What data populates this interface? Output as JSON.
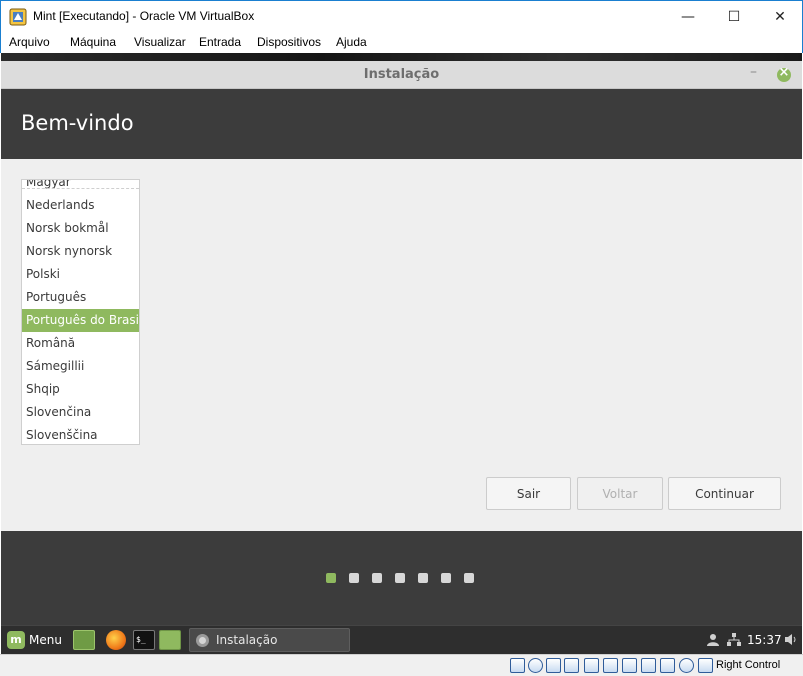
{
  "window": {
    "title": "Mint [Executando] - Oracle VM VirtualBox",
    "controls": {
      "minimize": "—",
      "maximize": "☐",
      "close": "✕"
    }
  },
  "menubar": {
    "items": [
      "Arquivo",
      "Máquina",
      "Visualizar",
      "Entrada",
      "Dispositivos",
      "Ajuda"
    ]
  },
  "installer": {
    "title": "Instalação",
    "heading": "Bem-vindo",
    "languages": [
      "Magyar",
      "Nederlands",
      "Norsk bokmål",
      "Norsk nynorsk",
      "Polski",
      "Português",
      "Português do Brasil",
      "Română",
      "Sámegillii",
      "Shqip",
      "Slovenčina",
      "Slovenščina"
    ],
    "selected_language": "Português do Brasil",
    "buttons": {
      "quit": "Sair",
      "back": "Voltar",
      "continue": "Continuar"
    },
    "progress": {
      "total_steps": 7,
      "current_step": 1
    }
  },
  "taskbar": {
    "menu_label": "Menu",
    "window_label": "Instalação",
    "clock": "15:37"
  },
  "statusbar": {
    "host_key": "Right Control"
  },
  "colors": {
    "accent": "#8fb95f",
    "header_bg": "#3c3c3c",
    "body_bg": "#efefef"
  }
}
